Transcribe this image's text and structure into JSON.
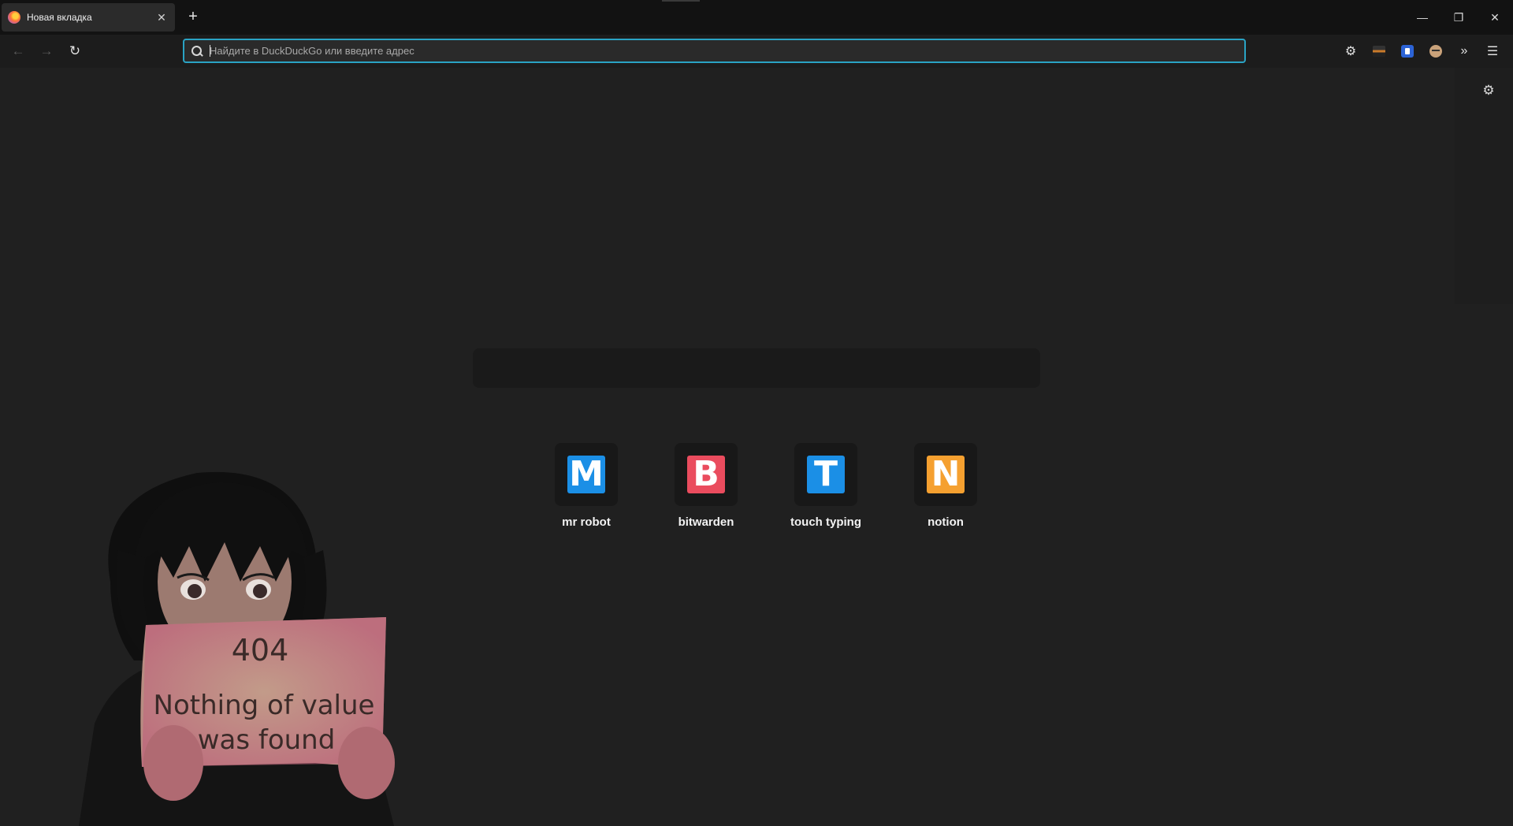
{
  "tabs": [
    {
      "title": "Новая вкладка",
      "close_glyph": "✕"
    }
  ],
  "tabstrip": {
    "new_tab_glyph": "+"
  },
  "window_controls": {
    "minimize": "—",
    "restore": "❐",
    "close": "✕"
  },
  "navbar": {
    "back_glyph": "←",
    "forward_glyph": "→",
    "reload_glyph": "↻",
    "url_placeholder": "Найдите в DuckDuckGo или введите адрес",
    "url_value": ""
  },
  "toolbar": {
    "settings_glyph": "⚙",
    "overflow_glyph": "»",
    "menu_glyph": "☰"
  },
  "page": {
    "settings_glyph": "⚙"
  },
  "shortcuts": [
    {
      "label": "mr robot",
      "letter": "M",
      "color": "#1b8fe6"
    },
    {
      "label": "bitwarden",
      "letter": "B",
      "color": "#ea4c5e"
    },
    {
      "label": "touch typing",
      "letter": "T",
      "color": "#1b8fe6"
    },
    {
      "label": "notion",
      "letter": "N",
      "color": "#f5a030"
    }
  ],
  "illustration": {
    "sign_line1": "404",
    "sign_line2": "Nothing of value",
    "sign_line3": "was found"
  },
  "colors": {
    "background": "#202020",
    "urlbar_focus": "#2aa3c4"
  }
}
